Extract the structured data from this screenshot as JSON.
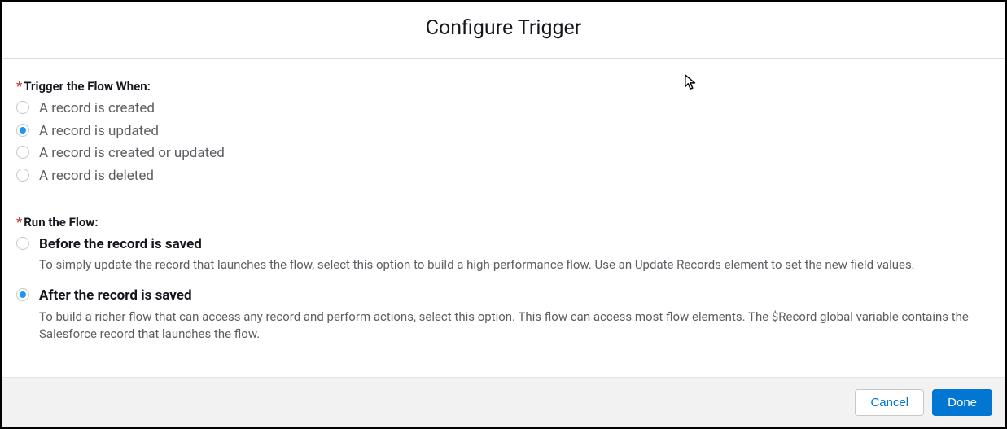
{
  "header": {
    "title": "Configure Trigger"
  },
  "trigger": {
    "label": "Trigger the Flow When:",
    "options": [
      {
        "label": "A record is created",
        "selected": false
      },
      {
        "label": "A record is updated",
        "selected": true
      },
      {
        "label": "A record is created or updated",
        "selected": false
      },
      {
        "label": "A record is deleted",
        "selected": false
      }
    ]
  },
  "run": {
    "label": "Run the Flow:",
    "options": [
      {
        "label": "Before the record is saved",
        "desc": "To simply update the record that launches the flow, select this option to build a high-performance flow. Use an Update Records element to set the new field values.",
        "selected": false
      },
      {
        "label": "After the record is saved",
        "desc": "To build a richer flow that can access any record and perform actions, select this option. This flow can access most flow elements. The $Record global variable contains the Salesforce record that launches the flow.",
        "selected": true
      }
    ]
  },
  "footer": {
    "cancel": "Cancel",
    "done": "Done"
  }
}
